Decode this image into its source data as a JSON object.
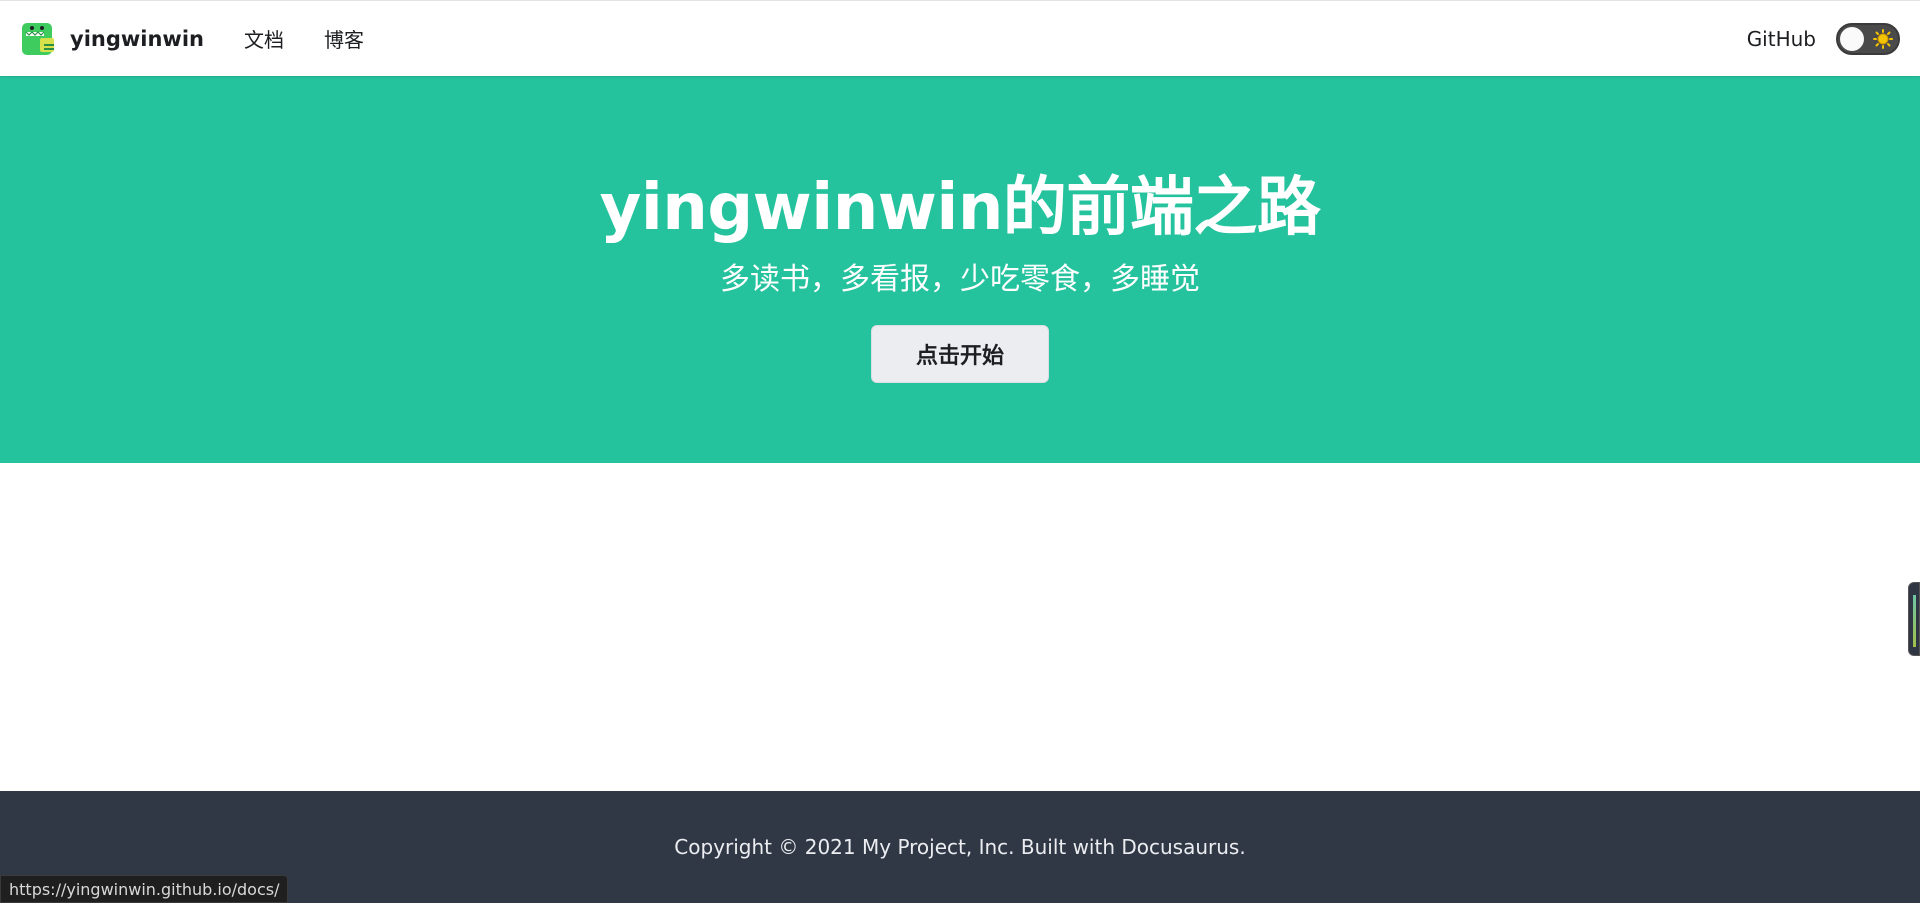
{
  "navbar": {
    "brand_title": "yingwinwin",
    "links": [
      {
        "label": "文档"
      },
      {
        "label": "博客"
      }
    ],
    "github_label": "GitHub",
    "theme_toggle_icon": "sun-icon"
  },
  "hero": {
    "title": "yingwinwin的前端之路",
    "subtitle": "多读书，多看报，少吃零食，多睡觉",
    "cta_label": "点击开始",
    "background_color": "#25c29e"
  },
  "footer": {
    "copyright": "Copyright © 2021 My Project, Inc. Built with Docusaurus.",
    "background_color": "#303846"
  },
  "status_bar": {
    "url": "https://yingwinwin.github.io/docs/"
  }
}
